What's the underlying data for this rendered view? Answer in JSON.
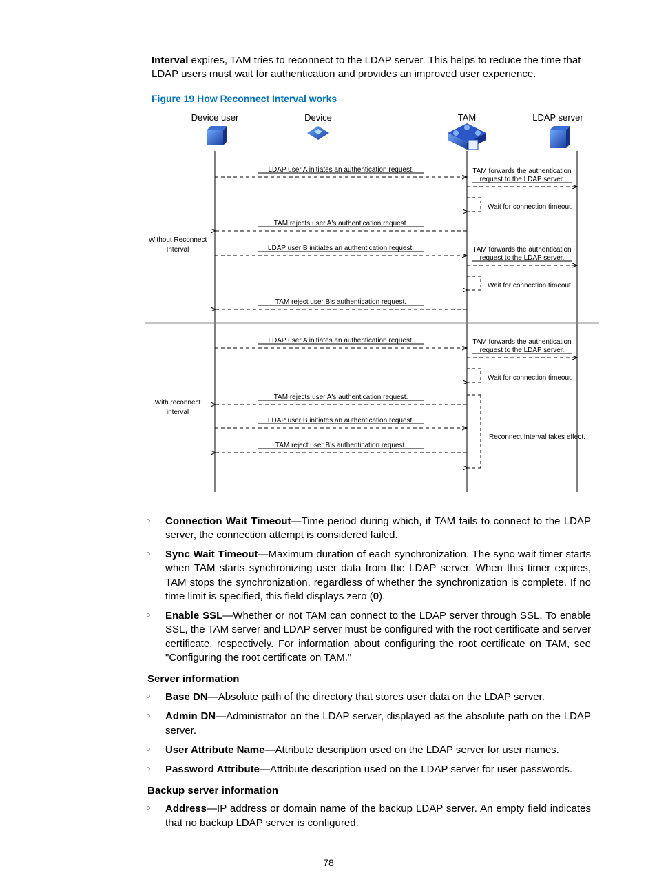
{
  "intro": {
    "bold_first": "Interval",
    "rest": " expires, TAM tries to reconnect to the LDAP server. This helps to reduce the time that LDAP users must wait for authentication and provides an improved user experience."
  },
  "figure_caption": "Figure 19 How Reconnect Interval works",
  "diagram": {
    "heads": {
      "device_user": "Device user",
      "device": "Device",
      "tam": "TAM",
      "ldap": "LDAP server"
    },
    "sections": {
      "without": [
        "Without Reconnect",
        "Interval"
      ],
      "with": [
        "With reconnect",
        "interval"
      ]
    },
    "labels": {
      "userA_auth": "LDAP user A initiates an authentication request.",
      "userB_auth": "LDAP user B initiates an authentication request.",
      "rejectA": "TAM rejects user A's authentication request.",
      "rejectB": "TAM reject user B's authentication request.",
      "fwd1": "TAM forwards the authentication",
      "fwd2": "request to the LDAP server.",
      "wait": "Wait for connection timeout.",
      "reconnect": "Reconnect Interval takes effect."
    }
  },
  "bullets_top": [
    {
      "term": "Connection Wait Timeout",
      "text": "—Time period during which, if TAM fails to connect to the LDAP server, the connection attempt is considered failed."
    },
    {
      "term": "Sync Wait Timeout",
      "text": "—Maximum duration of each synchronization. The sync wait timer starts when TAM starts synchronizing user data from the LDAP server. When this timer expires, TAM stops the synchronization, regardless of whether the synchronization is complete. If no time limit is specified, this field displays zero (",
      "bold_0": "0",
      "after_bold": ")."
    },
    {
      "term": "Enable SSL",
      "text": "—Whether or not TAM can connect to the LDAP server through SSL. To enable SSL, the TAM server and LDAP server must be configured with the root certificate and server certificate, respectively. For information about configuring the root certificate on TAM, see \"Configuring the root certificate on TAM.\""
    }
  ],
  "server_info_head": "Server information",
  "bullets_server": [
    {
      "term": "Base DN",
      "text": "—Absolute path of the directory that stores user data on the LDAP server."
    },
    {
      "term": "Admin DN",
      "text": "—Administrator on the LDAP server, displayed as the absolute path on the LDAP server."
    },
    {
      "term": "User Attribute Name",
      "text": "—Attribute description used on the LDAP server for user names."
    },
    {
      "term": "Password Attribute",
      "text": "—Attribute description used on the LDAP server for user passwords."
    }
  ],
  "backup_head": "Backup server information",
  "bullets_backup": [
    {
      "term": "Address",
      "text": "—IP address or domain name of the backup LDAP server. An empty field indicates that no backup LDAP server is configured."
    }
  ],
  "page_number": "78"
}
